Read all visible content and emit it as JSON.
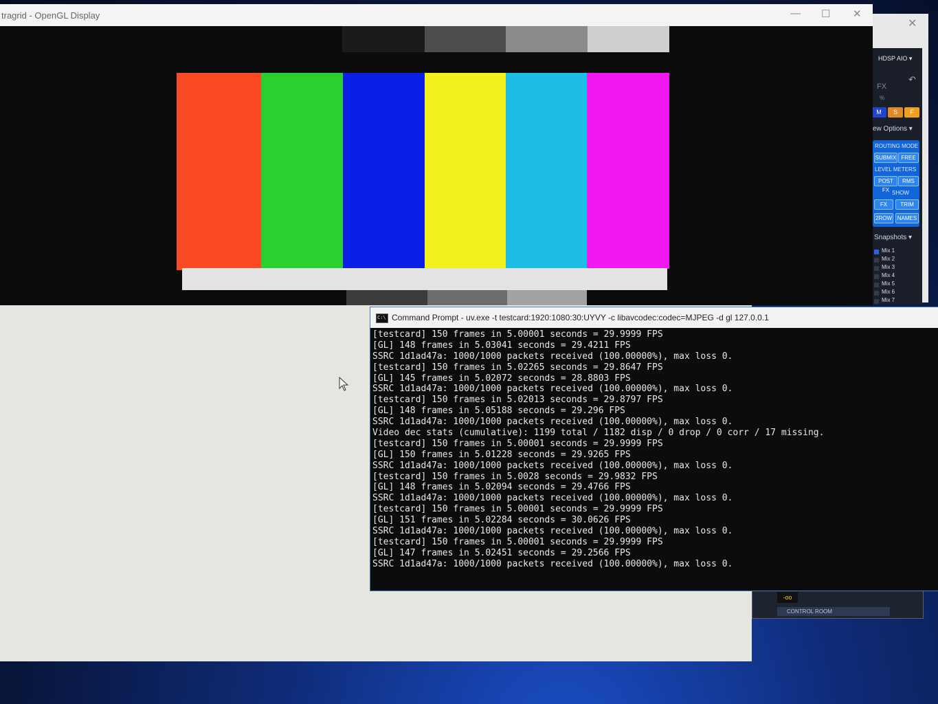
{
  "gl_window": {
    "title": "tragrid - OpenGL Display",
    "color_bars": [
      "#fb4a23",
      "#2bcf32",
      "#0a1ee6",
      "#f3f11f",
      "#1cbde6",
      "#f218f0"
    ],
    "top_greys": [
      "#1b1b1b",
      "#4d4d4d",
      "#8a8a8a",
      "#cfcfcf"
    ],
    "bottom_greys": [
      "#3b3b3b",
      "#6c6c6c",
      "#a2a2a2"
    ],
    "white_strip_color": "#e3e3e3"
  },
  "mixer": {
    "device": "HDSP AIO",
    "fx_label": "FX",
    "pct_label": "%",
    "msf": [
      "M",
      "S",
      "F"
    ],
    "view_options": "ew Options",
    "routing_mode": "ROUTING MODE",
    "submix": "SUBMIX",
    "free": "FREE",
    "level_meters": "LEVEL METERS",
    "post_fx": "POST FX",
    "rms": "RMS",
    "show": "SHOW",
    "fx": "FX",
    "trim": "TRIM",
    "two_row": "2ROW",
    "names": "NAMES",
    "snapshots": "Snapshots",
    "mixes": [
      "Mix 1",
      "Mix 2",
      "Mix 3",
      "Mix 4",
      "Mix 5",
      "Mix 6",
      "Mix 7"
    ],
    "inf_label": "-oo",
    "control_room": "CONTROL ROOM"
  },
  "cmd": {
    "title": "Command Prompt - uv.exe  -t testcard:1920:1080:30:UYVY -c libavcodec:codec=MJPEG -d gl 127.0.0.1",
    "icon_text": "C:\\",
    "lines": [
      "[testcard] 150 frames in 5.00001 seconds = 29.9999 FPS",
      "[GL] 148 frames in 5.03041 seconds = 29.4211 FPS",
      "SSRC 1d1ad47a: 1000/1000 packets received (100.00000%), max loss 0.",
      "[testcard] 150 frames in 5.02265 seconds = 29.8647 FPS",
      "[GL] 145 frames in 5.02072 seconds = 28.8803 FPS",
      "SSRC 1d1ad47a: 1000/1000 packets received (100.00000%), max loss 0.",
      "[testcard] 150 frames in 5.02013 seconds = 29.8797 FPS",
      "[GL] 148 frames in 5.05188 seconds = 29.296 FPS",
      "SSRC 1d1ad47a: 1000/1000 packets received (100.00000%), max loss 0.",
      "Video dec stats (cumulative): 1199 total / 1182 disp / 0 drop / 0 corr / 17 missing.",
      "[testcard] 150 frames in 5.00001 seconds = 29.9999 FPS",
      "[GL] 150 frames in 5.01228 seconds = 29.9265 FPS",
      "SSRC 1d1ad47a: 1000/1000 packets received (100.00000%), max loss 0.",
      "[testcard] 150 frames in 5.0028 seconds = 29.9832 FPS",
      "[GL] 148 frames in 5.02094 seconds = 29.4766 FPS",
      "SSRC 1d1ad47a: 1000/1000 packets received (100.00000%), max loss 0.",
      "[testcard] 150 frames in 5.00001 seconds = 29.9999 FPS",
      "[GL] 151 frames in 5.02284 seconds = 30.0626 FPS",
      "SSRC 1d1ad47a: 1000/1000 packets received (100.00000%), max loss 0.",
      "[testcard] 150 frames in 5.00001 seconds = 29.9999 FPS",
      "[GL] 147 frames in 5.02451 seconds = 29.2566 FPS",
      "SSRC 1d1ad47a: 1000/1000 packets received (100.00000%), max loss 0."
    ]
  }
}
